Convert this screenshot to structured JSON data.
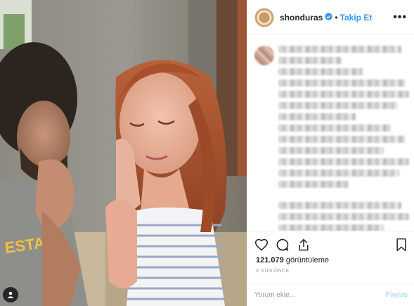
{
  "post": {
    "username": "shonduras",
    "separator": "•",
    "follow_label": "Takip Et",
    "more_label": "•••",
    "views_count": "121.079",
    "views_suffix": " görüntüleme",
    "time_ago": "3 GÜN ÖNCE",
    "comment_placeholder": "Yorum ekle...",
    "post_label": "Paylaş"
  },
  "media": {
    "shirt_text": "ESTATE"
  },
  "icons": {
    "verified": "verified-badge-icon",
    "like": "heart-icon",
    "comment": "comment-bubble-icon",
    "share": "share-icon",
    "save": "bookmark-icon",
    "more": "ellipsis-icon",
    "user_tag": "user-tag-icon"
  },
  "colors": {
    "accent": "#3897f0",
    "post_disabled": "#b2dffc",
    "text": "#262626",
    "muted": "#999999"
  }
}
